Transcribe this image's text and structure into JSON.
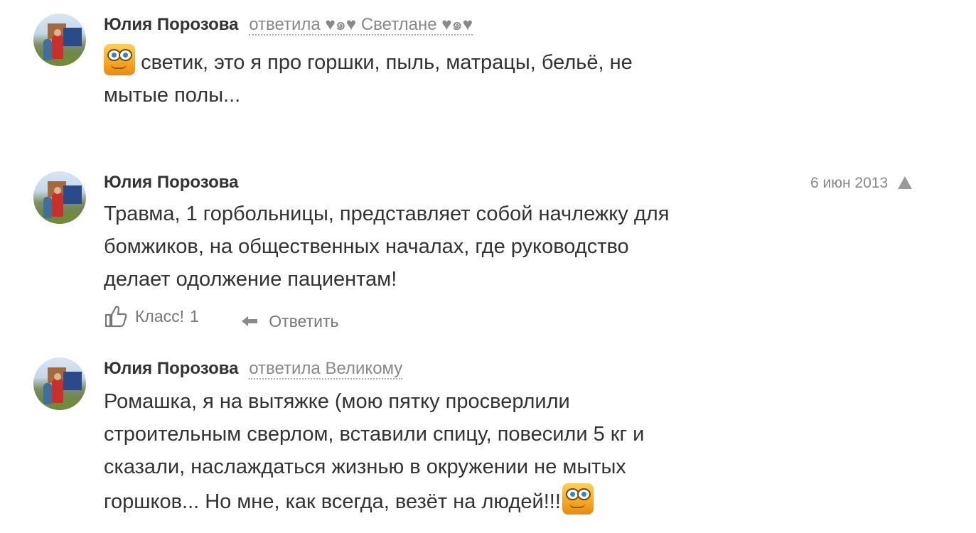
{
  "comments": [
    {
      "author": "Юлия Порозова",
      "reply_to": "ответила ♥๑♥ Светлане ♥๑♥",
      "text_line1": "светик, это я про горшки, пыль, матрацы, бельё, не",
      "text_line2": "мытые полы..."
    },
    {
      "author": "Юлия Порозова",
      "date": "6 июн 2013",
      "text_lines": [
        "Травма, 1 горбольницы, представляет собой начлежку для",
        "бомжиков, на общественных началах, где руководство",
        "делает одолжение пациентам!"
      ],
      "like_label": "Класс!",
      "like_count": "1",
      "reply_label": "Ответить"
    },
    {
      "author": "Юлия Порозова",
      "reply_to": "ответила Великому",
      "text_lines": [
        "Ромашка, я на вытяжке (мою пятку просверлили",
        "строительным сверлом, вставили спицу, повесили 5 кг и",
        "сказали, наслаждаться жизнью в окружении  не мытых",
        "горшков... Но мне, как всегда, везёт на людей!!!"
      ]
    }
  ],
  "icons": {
    "smiley": "smiley-emoticon-icon",
    "warning": "report-warning-icon",
    "like": "thumbs-up-icon",
    "reply": "reply-arrow-icon"
  }
}
